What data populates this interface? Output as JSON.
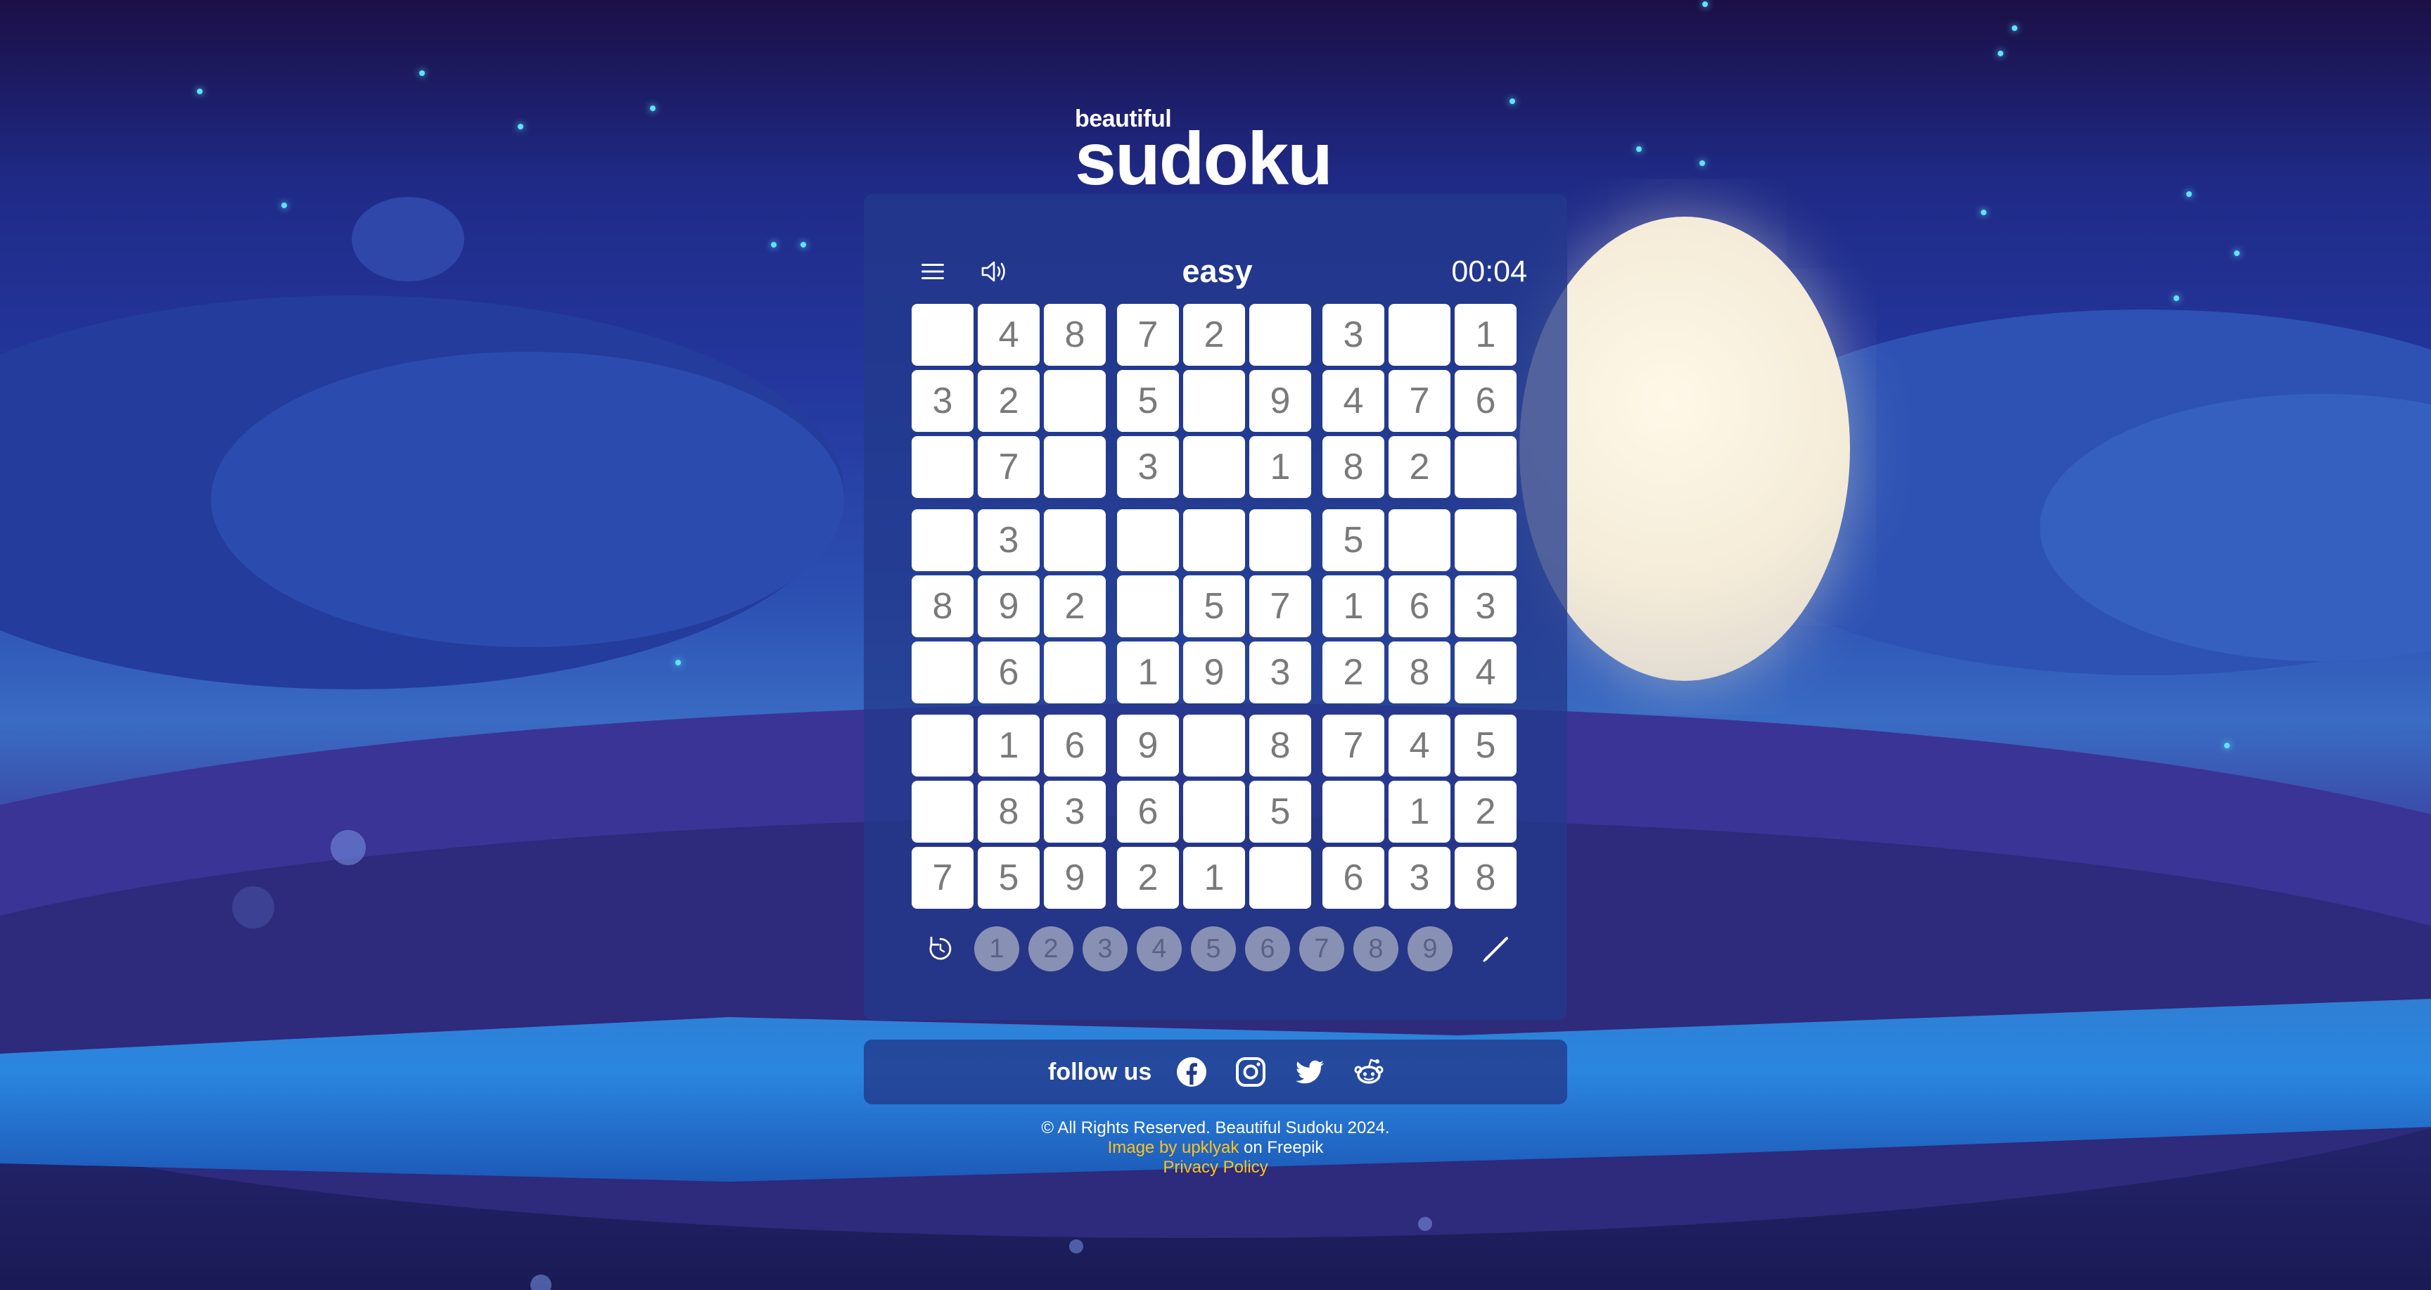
{
  "logo": {
    "line1": "beautiful",
    "line2": "sudoku"
  },
  "game": {
    "difficulty": "easy",
    "timer": "00:04",
    "grid": [
      [
        "",
        "4",
        "8",
        "7",
        "2",
        "",
        "3",
        "",
        "1"
      ],
      [
        "3",
        "2",
        "",
        "5",
        "",
        "9",
        "4",
        "7",
        "6"
      ],
      [
        "",
        "7",
        "",
        "3",
        "",
        "1",
        "8",
        "2",
        ""
      ],
      [
        "",
        "3",
        "",
        "",
        "",
        "",
        "5",
        "",
        ""
      ],
      [
        "8",
        "9",
        "2",
        "",
        "5",
        "7",
        "1",
        "6",
        "3"
      ],
      [
        "",
        "6",
        "",
        "1",
        "9",
        "3",
        "2",
        "8",
        "4"
      ],
      [
        "",
        "1",
        "6",
        "9",
        "",
        "8",
        "7",
        "4",
        "5"
      ],
      [
        "",
        "8",
        "3",
        "6",
        "",
        "5",
        "",
        "1",
        "2"
      ],
      [
        "7",
        "5",
        "9",
        "2",
        "1",
        "",
        "6",
        "3",
        "8"
      ]
    ],
    "number_buttons": [
      "1",
      "2",
      "3",
      "4",
      "5",
      "6",
      "7",
      "8",
      "9"
    ]
  },
  "icons": {
    "menu": "menu-icon",
    "sound": "speaker-icon",
    "undo": "undo-icon",
    "pencil": "pencil-icon",
    "facebook": "facebook-icon",
    "instagram": "instagram-icon",
    "twitter": "twitter-icon",
    "reddit": "reddit-icon"
  },
  "follow": {
    "label": "follow us"
  },
  "footer": {
    "copyright": "© All Rights Reserved. Beautiful Sudoku 2024.",
    "image_credit_link": "Image by upklyak",
    "image_credit_suffix": " on Freepik",
    "privacy": "Privacy Policy"
  },
  "colors": {
    "card": "#233a8c",
    "cell": "#ffffff",
    "digit": "#7a7a7a",
    "number_button": "#8891b4",
    "link": "#ffc21a"
  }
}
